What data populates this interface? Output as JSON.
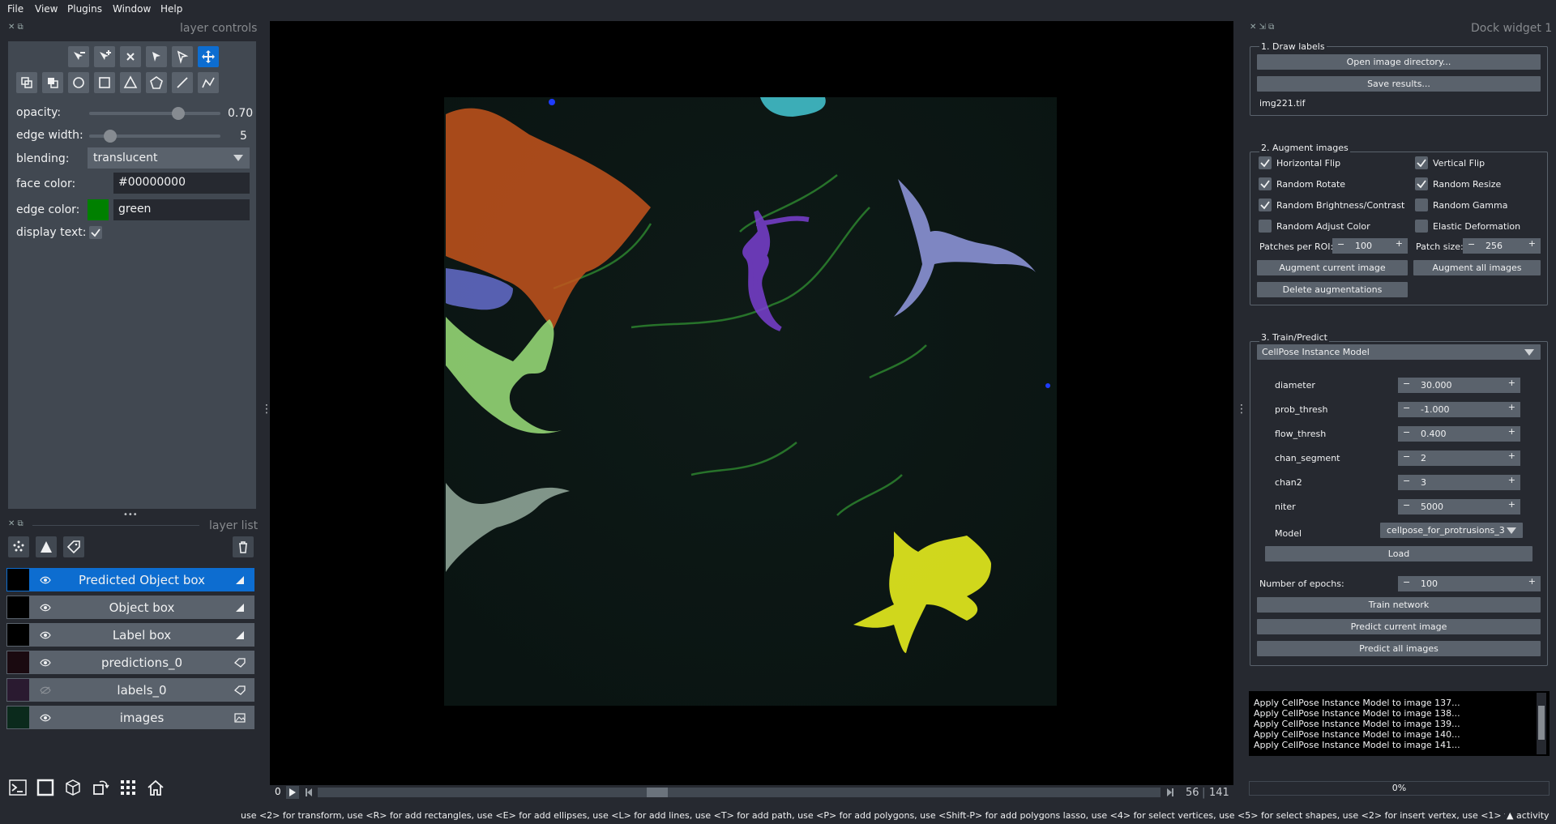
{
  "menu": [
    "File",
    "View",
    "Plugins",
    "Window",
    "Help"
  ],
  "layer_controls": {
    "title": "layer controls",
    "opacity_label": "opacity:",
    "opacity_value": "0.70",
    "opacity_level": 0.7,
    "edge_width_label": "edge width:",
    "edge_width_value": "5",
    "blending_label": "blending:",
    "blending_value": "translucent",
    "face_color_label": "face color:",
    "face_color_value": "#00000000",
    "edge_color_label": "edge color:",
    "edge_color_value": "green",
    "edge_color_swatch": "#008000",
    "display_text_label": "display text:",
    "display_text_checked": true
  },
  "layer_list": {
    "title": "layer list",
    "layers": [
      {
        "name": "Predicted Object box",
        "type": "shapes",
        "visible": true,
        "selected": true
      },
      {
        "name": "Object box",
        "type": "shapes",
        "visible": true,
        "selected": false
      },
      {
        "name": "Label box",
        "type": "shapes",
        "visible": true,
        "selected": false
      },
      {
        "name": "predictions_0",
        "type": "labels",
        "visible": true,
        "selected": false
      },
      {
        "name": "labels_0",
        "type": "labels",
        "visible": false,
        "selected": false
      },
      {
        "name": "images",
        "type": "image",
        "visible": true,
        "selected": false
      }
    ]
  },
  "canvas": {
    "frame_start": "0",
    "current_frame": "56",
    "total_frames": "141",
    "frame_progress": 0.4
  },
  "dock": {
    "title": "Dock widget 1",
    "draw_labels": {
      "title": "1. Draw labels",
      "open_btn": "Open image directory...",
      "save_btn": "Save results...",
      "filename": "img221.tif"
    },
    "augment": {
      "title": "2. Augment images",
      "checks": [
        {
          "label": "Horizontal Flip",
          "checked": true
        },
        {
          "label": "Vertical Flip",
          "checked": true
        },
        {
          "label": "Random Rotate",
          "checked": true
        },
        {
          "label": "Random Resize",
          "checked": true
        },
        {
          "label": "Random Brightness/Contrast",
          "checked": true
        },
        {
          "label": "Random Gamma",
          "checked": false
        },
        {
          "label": "Random Adjust Color",
          "checked": false
        },
        {
          "label": "Elastic Deformation",
          "checked": false
        }
      ],
      "patches_label": "Patches per ROI:",
      "patches_value": "100",
      "patch_size_label": "Patch size:",
      "patch_size_value": "256",
      "augment_current": "Augment current image",
      "augment_all": "Augment all images",
      "delete_aug": "Delete augmentations"
    },
    "train": {
      "title": "3. Train/Predict",
      "model_type": "CellPose Instance Model",
      "params": [
        {
          "label": "diameter",
          "value": "30.000"
        },
        {
          "label": "prob_thresh",
          "value": "-1.000"
        },
        {
          "label": "flow_thresh",
          "value": "0.400"
        },
        {
          "label": "chan_segment",
          "value": "2"
        },
        {
          "label": "chan2",
          "value": "3"
        },
        {
          "label": "niter",
          "value": "5000"
        }
      ],
      "model_label": "Model",
      "model_value": "cellpose_for_protrusions_3",
      "load_btn": "Load",
      "epochs_label": "Number of epochs:",
      "epochs_value": "100",
      "train_btn": "Train network",
      "predict_current": "Predict current image",
      "predict_all": "Predict all images"
    },
    "log": [
      "Apply CellPose Instance Model to image 137...",
      "Apply CellPose Instance Model to image 138...",
      "Apply CellPose Instance Model to image 139...",
      "Apply CellPose Instance Model to image 140...",
      "Apply CellPose Instance Model to image 141..."
    ],
    "progress_text": "0%"
  },
  "status": {
    "hint": "use <2> for transform, use <R> for add rectangles, use <E> for add ellipses, use <L> for add lines, use <T> for add path, use <P> for add polygons, use <Shift-P> for add polygons lasso, use <4> for select vertices, use <5> for select shapes, use <2> for insert vertex, use <1> for remove vertex",
    "activity": "activity"
  }
}
